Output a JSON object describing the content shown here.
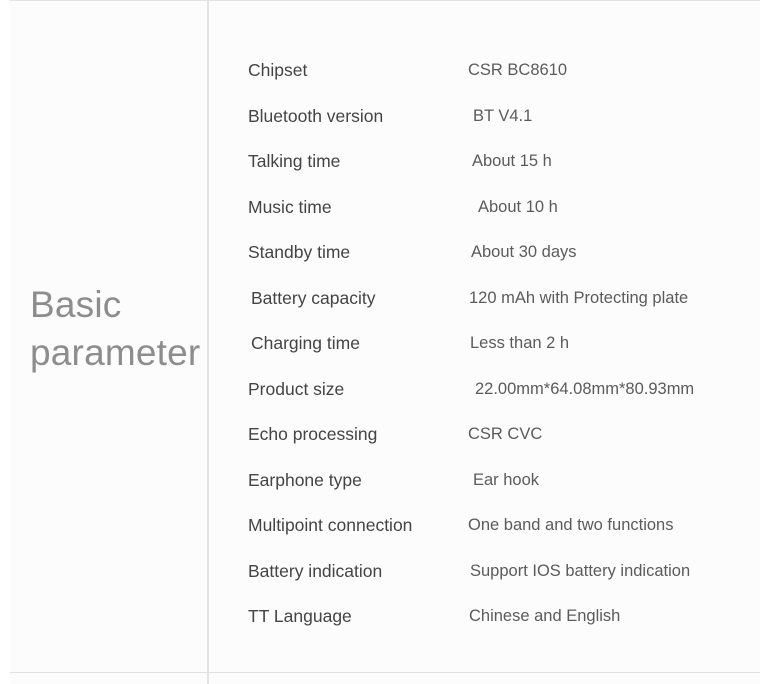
{
  "panel": {
    "heading": "Basic\nparameter",
    "heading_color": "#8d8d8d",
    "background_color": "#fcfcfc",
    "divider_color": "#e4e4e4",
    "label_color": "#444444",
    "value_color": "#5b5b5b"
  },
  "spec_rows": [
    {
      "label": "Chipset",
      "value": "CSR BC8610"
    },
    {
      "label": "Bluetooth version",
      "value": "BT V4.1"
    },
    {
      "label": "Talking time",
      "value": "About 15 h"
    },
    {
      "label": "Music time",
      "value": "About 10 h"
    },
    {
      "label": "Standby time",
      "value": "About 30 days"
    },
    {
      "label": "Battery capacity",
      "value": "120 mAh with Protecting plate"
    },
    {
      "label": "Charging time",
      "value": "Less than 2 h"
    },
    {
      "label": "Product size",
      "value": "22.00mm*64.08mm*80.93mm"
    },
    {
      "label": "Echo processing",
      "value": "CSR CVC"
    },
    {
      "label": "Earphone type",
      "value": "Ear hook"
    },
    {
      "label": "Multipoint connection",
      "value": "One band and two functions"
    },
    {
      "label": "Battery indication",
      "value": "Support IOS battery indication"
    },
    {
      "label": "TT Language",
      "value": "Chinese and English"
    }
  ]
}
